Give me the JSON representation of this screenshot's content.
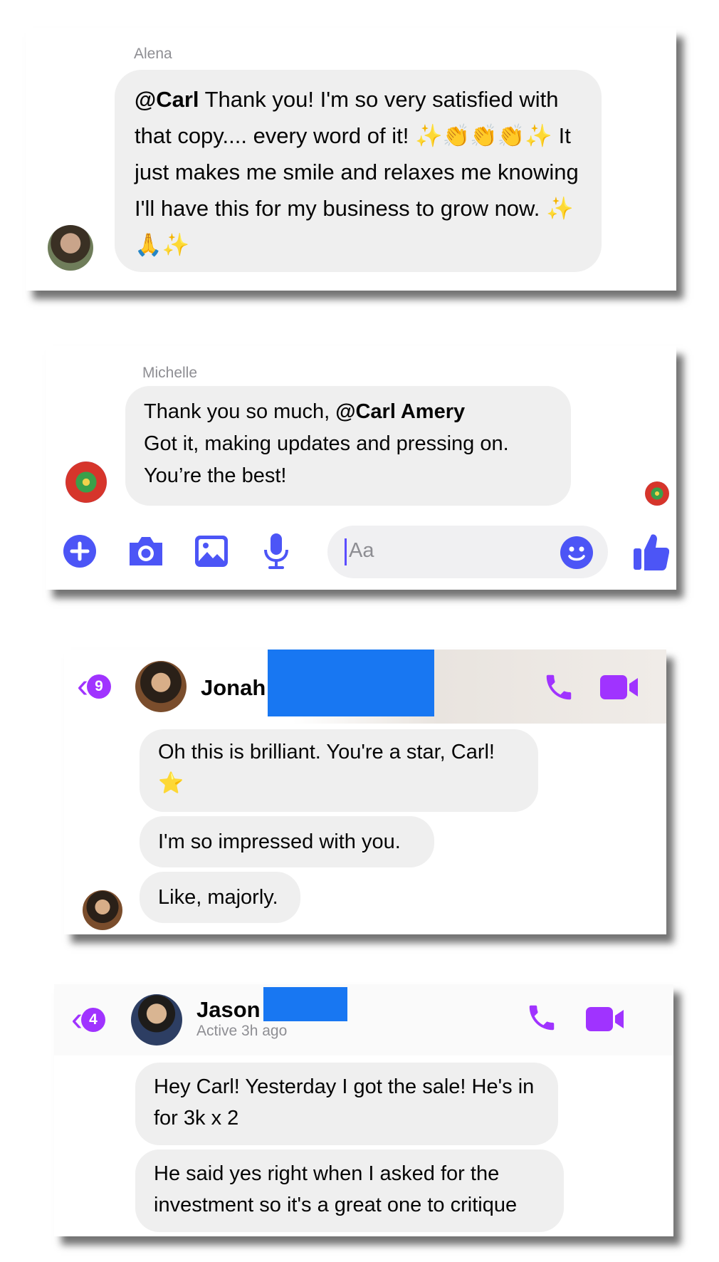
{
  "alena": {
    "sender": "Alena",
    "mention": "@Carl",
    "message": " Thank you! I'm so very satisfied with that copy.... every word of it! ✨👏👏👏✨ It just makes me smile and relaxes me knowing I'll have this for my business to grow now. ✨🙏✨"
  },
  "michelle": {
    "sender": "Michelle",
    "message_prefix": "Thank you so much, ",
    "mention": "@Carl Amery",
    "message_rest": "Got it, making updates and pressing on. You’re the best!"
  },
  "composer": {
    "placeholder": "Aa",
    "icons": [
      "plus-circle-icon",
      "camera-icon",
      "image-icon",
      "microphone-icon",
      "emoji-icon",
      "thumbs-up-icon"
    ],
    "accent": "#4c55f6"
  },
  "jonah": {
    "back_count": "9",
    "name": "Jonah",
    "messages": [
      "Oh this is brilliant. You're a star, Carl! ⭐",
      "I'm so impressed with you.",
      "Like, majorly."
    ],
    "accent": "#a033ff"
  },
  "jason": {
    "back_count": "4",
    "name": "Jason",
    "status": "Active 3h ago",
    "messages": [
      "Hey Carl! Yesterday I got the sale! He's in for 3k x 2",
      "He said yes right when I asked for the investment so it's a great one to critique"
    ],
    "accent": "#a033ff"
  },
  "redaction_color": "#1877f2"
}
